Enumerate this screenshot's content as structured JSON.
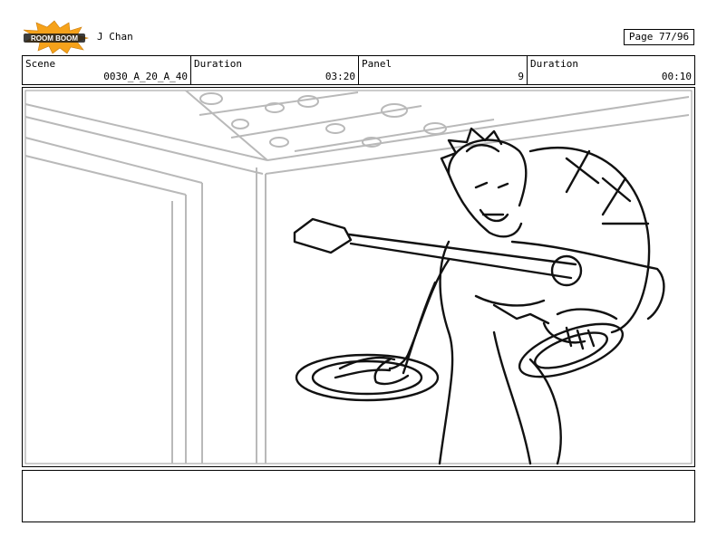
{
  "header": {
    "logo_text": "ROOM BOOM",
    "project": "J Chan",
    "page": "Page 77/96"
  },
  "info": {
    "scene_label": "Scene",
    "scene_value": "0030_A_20_A_40",
    "duration_label": "Duration",
    "duration_value": "03:20",
    "panel_label": "Panel",
    "panel_value": "9",
    "duration2_label": "Duration",
    "duration2_value": "00:10"
  },
  "panel": {
    "notes": ""
  },
  "colors": {
    "logo_orange": "#f6a21a",
    "logo_dark": "#1b1b1b",
    "sketch_grey": "#b9b9b9"
  }
}
